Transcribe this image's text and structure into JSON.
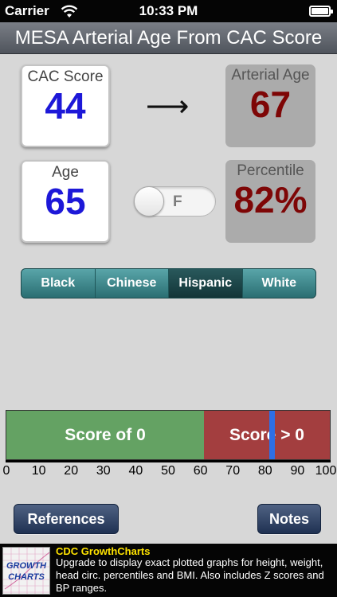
{
  "status_bar": {
    "carrier": "Carrier",
    "time": "10:33 PM"
  },
  "title": "MESA Arterial Age From CAC Score",
  "cac_score": {
    "label": "CAC Score",
    "value": "44"
  },
  "arrow": "⟶",
  "arterial_age": {
    "label": "Arterial Age",
    "value": "67"
  },
  "age": {
    "label": "Age",
    "value": "65"
  },
  "sex_toggle": {
    "label": "F",
    "on": false
  },
  "percentile": {
    "label": "Percentile",
    "value": "82%"
  },
  "ethnicity": {
    "options": [
      "Black",
      "Chinese",
      "Hispanic",
      "White"
    ],
    "selected": "Hispanic"
  },
  "score_bar": {
    "left_label": "Score of 0",
    "right_label": "Score > 0",
    "zero_score_percent": 61,
    "patient_percentile": 82,
    "axis_ticks": [
      "0",
      "10",
      "20",
      "30",
      "40",
      "50",
      "60",
      "70",
      "80",
      "90",
      "100"
    ],
    "colors": {
      "zero_zone": "#64a263",
      "positive_zone": "#a33e3f",
      "marker": "#2e6fe5"
    }
  },
  "buttons": {
    "references": "References",
    "notes": "Notes"
  },
  "ad": {
    "logo_line1": "GROWTH",
    "logo_line2": "CHARTS",
    "title": "CDC GrowthCharts",
    "text": "Upgrade to display exact plotted graphs for height, weight, head circ. percentiles and BMI.  Also includes Z scores and BP ranges."
  }
}
